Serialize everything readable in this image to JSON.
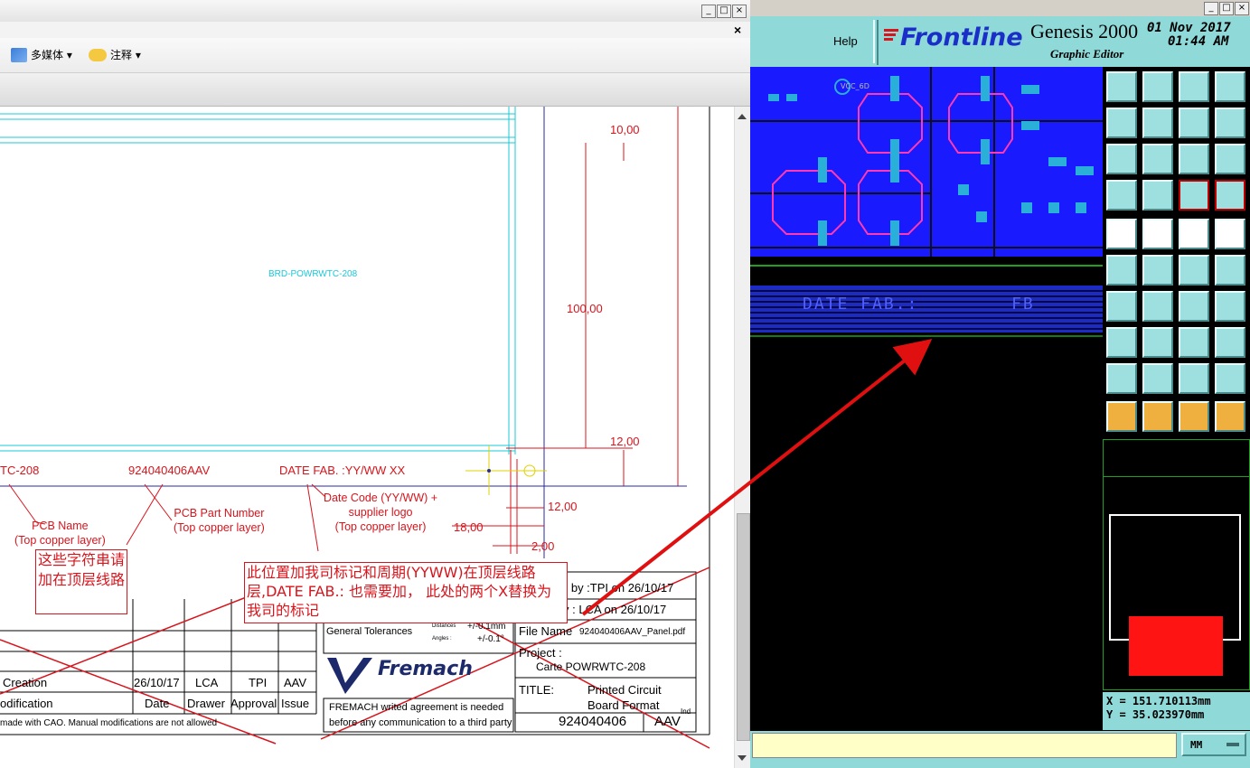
{
  "left_window": {
    "close_tab_glyph": "×",
    "toolbar": {
      "multimedia_label": "多媒体 ▾",
      "comment_label": "注释 ▾"
    }
  },
  "drawing": {
    "board_label": "BRD-POWRWTC-208",
    "dims": {
      "d1": "10,00",
      "d2": "100,00",
      "d3": "12,00",
      "d4": "12,00",
      "d5": "18,00",
      "d6": "2,00"
    },
    "row_labels": {
      "pcb_name_partial": "TC-208",
      "part_number": "924040406AAV",
      "date_fab": "DATE FAB. :YY/WW XX"
    },
    "annotations": {
      "pcb_name": [
        "PCB Name",
        "(Top copper layer)"
      ],
      "part_number": [
        "PCB Part Number",
        "(Top copper layer)"
      ],
      "date_code": [
        "Date Code (YY/WW) +",
        "supplier logo",
        "(Top copper layer)"
      ]
    },
    "note_small": "这些字符串请加在顶层线路",
    "note_large": "此位置加我司标记和周期(YYWW)在顶层线路层,DATE FAB.: 也需要加， 此处的两个X替换为我司的标记"
  },
  "title_block": {
    "checked_by": "d by :TPI on 26/10/17",
    "drawer": "y : LCA on 26/10/17",
    "general_tolerances": "General Tolerances",
    "dist_label": "Distances",
    "dist_value": "+/-0.1mm",
    "angles_label": "Angles :",
    "angles_value": "+/-0.1°",
    "file_name_label": "File Name",
    "file_name_value": "924040406AAV_Panel.pdf",
    "project_label": "Project :",
    "project_value": "Carte POWRWTC-208",
    "title_label": "TITLE:",
    "title_value_1": "Printed Circuit",
    "title_value_2": "Board Format",
    "ind_label": "Ind",
    "part_number": "924040406",
    "issue": "AAV",
    "brand": "Fremach",
    "agreement_1": "FREMACH writed agreement is needed",
    "agreement_2": "before any communication to a third party",
    "rev_rows": [
      {
        "desc": "Creation",
        "date": "26/10/17",
        "drawer": "LCA",
        "approval": "TPI",
        "issue": "AAV"
      },
      {
        "desc": "odification",
        "date": "Date",
        "drawer": "Drawer",
        "approval": "Approval",
        "issue": "Issue"
      }
    ],
    "footer_note": "made with CAO. Manual modifications are not allowed"
  },
  "genesis": {
    "help_label": "Help",
    "brand": "Frontline",
    "product": "Genesis 2000",
    "subtitle": "Graphic Editor",
    "date": "01 Nov 2017",
    "time": "01:44 AM",
    "pcb_text": "DATE FAB.:        FB",
    "vcc_label": "VCC_6D",
    "coord_x": "X = 151.710113mm",
    "coord_y": "Y = 35.023970mm",
    "units": "MM"
  },
  "colors": {
    "accent_red": "#d8141c",
    "genesis_cyan": "#8fd9d9",
    "pcb_blue": "#1a1aff"
  }
}
